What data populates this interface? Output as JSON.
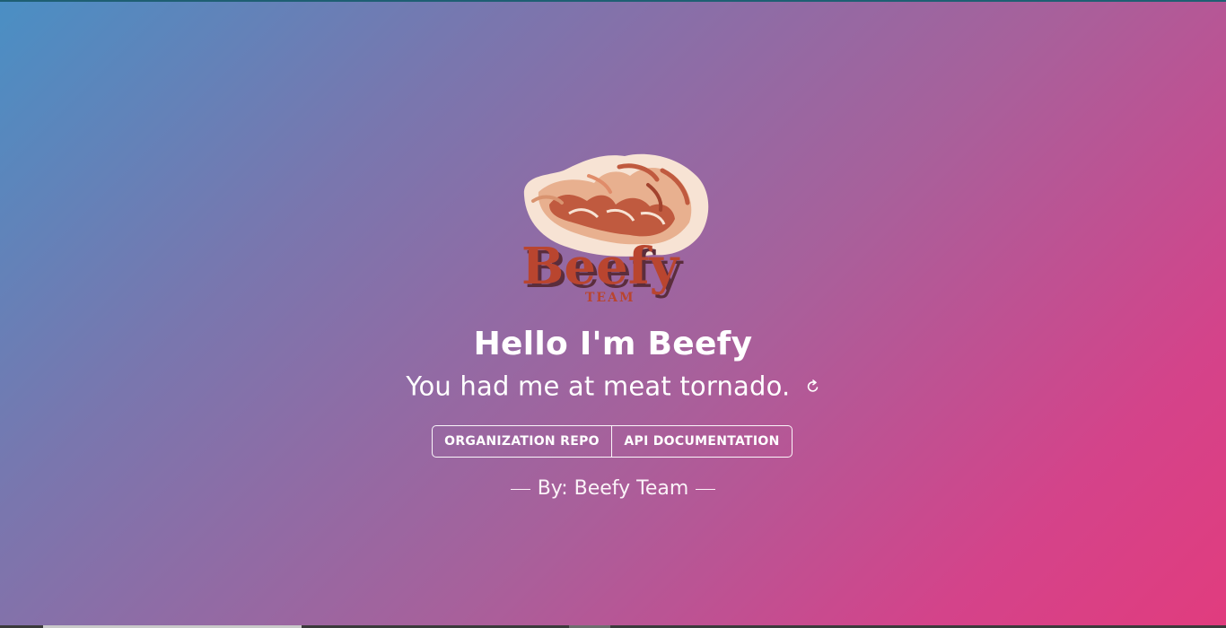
{
  "hero": {
    "logo": {
      "icon": "beefy-team-logo",
      "wordmark": "Beefy",
      "subtitle": "TEAM"
    },
    "title": "Hello I'm Beefy",
    "tagline": "You had me at meat tornado.",
    "refresh_icon": "refresh-icon"
  },
  "buttons": {
    "organization_repo": "ORGANIZATION REPO",
    "api_documentation": "API DOCUMENTATION"
  },
  "footer": {
    "byline": "By: Beefy Team"
  },
  "colors": {
    "gradient_start": "#4a8fc4",
    "gradient_mid": "#a8609b",
    "gradient_end": "#e13c7e",
    "logo_red": "#b9452f",
    "text": "#ffffff"
  }
}
